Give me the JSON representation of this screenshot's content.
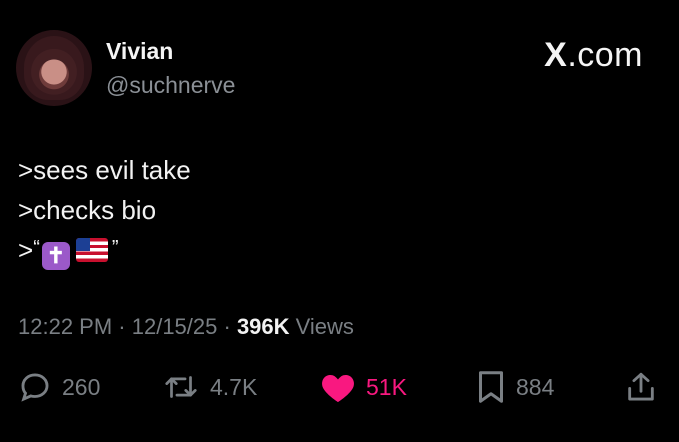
{
  "author": {
    "name": "Vivian",
    "handle": "@suchnerve"
  },
  "brand": {
    "logo_letter": "X",
    "suffix": ".com"
  },
  "post": {
    "lines": [
      ">sees evil take",
      ">checks bio"
    ],
    "third_line_prefix": ">",
    "open_quote": "“",
    "close_quote": "”",
    "emoji": [
      "latin-cross-emoji",
      "us-flag-emoji"
    ]
  },
  "meta": {
    "time": "12:22 PM",
    "sep1": " · ",
    "date": "12/15/25",
    "sep2": " · ",
    "views_count": "396K",
    "views_label": " Views"
  },
  "actions": {
    "replies": "260",
    "reposts": "4.7K",
    "likes": "51K",
    "bookmarks": "884"
  },
  "colors": {
    "background": "#000000",
    "like_accent": "#f91880",
    "muted": "#7a7f84"
  }
}
